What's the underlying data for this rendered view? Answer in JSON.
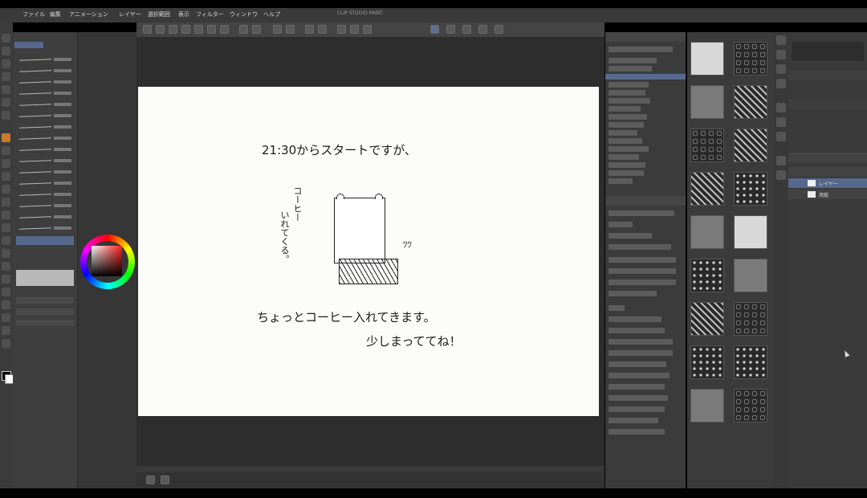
{
  "menubar": {
    "items": [
      "ファイル",
      "編集",
      "アニメーション",
      "レイヤー",
      "選択範囲",
      "表示",
      "フィルター",
      "ウィンドウ",
      "ヘルプ"
    ],
    "title": "CLIP STUDIO PAINT"
  },
  "canvas": {
    "line1": "21:30からスタートですが、",
    "side_text_a": "コーヒー",
    "side_text_b": "いれてくる。",
    "sound": "ﾂﾂ",
    "line2": "ちょっとコーヒー入れてきます。",
    "line3": "少しまっててね！"
  },
  "layers": {
    "rows": [
      "レイヤー",
      "用紙"
    ]
  },
  "colors": {
    "accent": "#56698c",
    "active_tool": "#c87c2a",
    "panel": "#3b3b3b",
    "paper": "#fcfcfa"
  }
}
